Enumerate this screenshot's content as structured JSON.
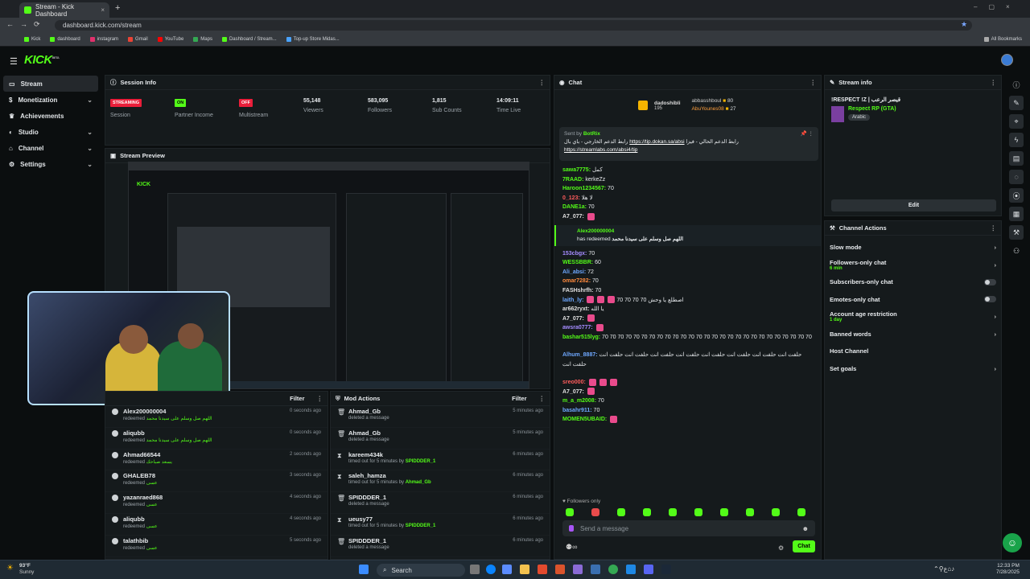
{
  "browser": {
    "tab_title": "Stream - Kick Dashboard",
    "url": "dashboard.kick.com/stream",
    "bookmarks": [
      "Kick",
      "dashboard",
      "instagram",
      "Gmail",
      "YouTube",
      "Maps",
      "Dashboard / Stream...",
      "Top-up Store Midas..."
    ],
    "all_bookmarks": "All Bookmarks"
  },
  "app": {
    "logo": "KICK",
    "logo_sup": "BETA"
  },
  "sidebar": {
    "items": [
      {
        "label": "Stream"
      },
      {
        "label": "Monetization"
      },
      {
        "label": "Achievements"
      },
      {
        "label": "Studio"
      },
      {
        "label": "Channel"
      },
      {
        "label": "Settings"
      }
    ]
  },
  "session": {
    "title": "Session Info",
    "stats": [
      {
        "badge": "STREAMING",
        "label": "Session"
      },
      {
        "badge": "ON",
        "label": "Partner Income"
      },
      {
        "badge": "OFF",
        "label": "Multistream"
      },
      {
        "value": "55,148",
        "label": "Viewers"
      },
      {
        "value": "583,095",
        "label": "Followers"
      },
      {
        "value": "1,815",
        "label": "Sub Counts"
      },
      {
        "value": "14:09:11",
        "label": "Time Live"
      }
    ]
  },
  "preview": {
    "title": "Stream Preview"
  },
  "activity": {
    "filter": "Filter",
    "items": [
      {
        "name": "Alex200000004",
        "sub": "redeemed",
        "extra": "اللهم صل وسلم على سيدنا محمد",
        "time": "0 seconds ago"
      },
      {
        "name": "aliqubb",
        "sub": "redeemed",
        "extra": "اللهم صل وسلم على سيدنا محمد",
        "time": "0 seconds ago"
      },
      {
        "name": "Ahmad66544",
        "sub": "redeemed",
        "extra": "يسعد صباحك",
        "time": "2 seconds ago"
      },
      {
        "name": "GHALEB78",
        "sub": "redeemed",
        "extra": "عسى",
        "time": "3 seconds ago"
      },
      {
        "name": "yazanraed868",
        "sub": "redeemed",
        "extra": "عسى",
        "time": "4 seconds ago"
      },
      {
        "name": "aliqubb",
        "sub": "redeemed",
        "extra": "عسى",
        "time": "4 seconds ago"
      },
      {
        "name": "talathbib",
        "sub": "redeemed",
        "extra": "عسى",
        "time": "5 seconds ago"
      }
    ]
  },
  "mod_actions": {
    "title": "Mod Actions",
    "filter": "Filter",
    "items": [
      {
        "name": "Ahmad_Gb",
        "sub": "deleted a message",
        "by": "",
        "time": "5 minutes ago"
      },
      {
        "name": "Ahmad_Gb",
        "sub": "deleted a message",
        "by": "",
        "time": "5 minutes ago"
      },
      {
        "name": "kareem434k",
        "sub": "timed out for 5 minutes by",
        "by": "SPIDDDER_1",
        "time": "6 minutes ago"
      },
      {
        "name": "saleh_hamza",
        "sub": "timed out for 5 minutes by",
        "by": "Ahmad_Gb",
        "time": "6 minutes ago"
      },
      {
        "name": "SPIDDDER_1",
        "sub": "deleted a message",
        "by": "",
        "time": "6 minutes ago"
      },
      {
        "name": "ueusy77",
        "sub": "timed out for 5 minutes by",
        "by": "SPIDDDER_1",
        "time": "6 minutes ago"
      },
      {
        "name": "SPIDDDER_1",
        "sub": "deleted a message",
        "by": "",
        "time": "6 minutes ago"
      }
    ]
  },
  "chat": {
    "title": "Chat",
    "top_gifter": {
      "name": "dadoshibli",
      "count": "195"
    },
    "gifters": [
      {
        "name": "abbasshboul",
        "count": "80"
      },
      {
        "name": "AbuYounes08",
        "count": "27"
      }
    ],
    "pinned": {
      "sent_by": "Sent by",
      "bot": "BotRix",
      "text": "رابط الدعم الحالي - فيزا",
      "link1": "https://tip.dokan.sa/absi",
      "text2": "رابط الدعم الخارجي - باي بال",
      "link2": "https://streamlabs.com/absi4/tip"
    },
    "messages": [
      {
        "user": "sawa7775:",
        "text": "كمل",
        "color": "#53fc18"
      },
      {
        "user": "7RAAD:",
        "text": "kerkeZz",
        "color": "#53fc18"
      },
      {
        "user": "Haroon1234567:",
        "text": "70",
        "color": "#53fc18"
      },
      {
        "user": "0_123:",
        "text": "لا هلا",
        "color": "#ff5c5c"
      },
      {
        "user": "DANE1a:",
        "text": "70",
        "color": "#53fc18"
      },
      {
        "user": "A7_077:",
        "text": "",
        "color": "#e0e0e0",
        "emote": 1
      },
      {
        "user": "153cbgx:",
        "text": "70",
        "color": "#a58cff"
      },
      {
        "user": "WESSBBR:",
        "text": "60",
        "color": "#53fc18"
      },
      {
        "user": "Ali_absi:",
        "text": "72",
        "color": "#6ea8ff"
      },
      {
        "user": "omar7282:",
        "text": "70",
        "color": "#ff8a3d"
      },
      {
        "user": "FASHshrfh:",
        "text": "70",
        "color": "#e0e0e0"
      },
      {
        "user": "laith_ly:",
        "text": "70 70 70 70 اصطلع يا وحش",
        "color": "#6ea8ff",
        "emote": 3
      },
      {
        "user": "ar662ryxt:",
        "text": "يا الله",
        "color": "#e0e0e0"
      },
      {
        "user": "A7_077:",
        "text": "",
        "color": "#e0e0e0",
        "emote": 1
      },
      {
        "user": "awsra0777:",
        "text": "",
        "color": "#a58cff",
        "emote": 1
      },
      {
        "user": "bashar515lyg:",
        "text": "70 70 70 70 70 70 70 70 70 70 70 70 70 70 70 70 70 70 70 70 70 70 70 70 70 70 70",
        "color": "#53fc18"
      },
      {
        "user": "Alhum_8887:",
        "text": "حلفت انت حلفت انت حلفت انت حلفت انت حلفت انت حلفت انت حلفت انت حلفت انت حلفت انت",
        "color": "#6ea8ff",
        "long": true
      },
      {
        "user": "sreo000:",
        "text": "",
        "color": "#ff5c5c",
        "emote": 3
      },
      {
        "user": "A7_077:",
        "text": "",
        "color": "#e0e0e0",
        "emote": 1
      },
      {
        "user": "m_a_m2008:",
        "text": "70",
        "color": "#53fc18"
      },
      {
        "user": "basahr911:",
        "text": "70",
        "color": "#6ea8ff"
      },
      {
        "user": "MOMEN5UBAID:",
        "text": "",
        "color": "#53fc18",
        "emote": 1
      }
    ],
    "redeem": {
      "user": "Alex200000004",
      "text": "has redeemed",
      "reward": "اللهم صل وسلم على سيدنا محمد"
    },
    "followers_only": "Followers only",
    "input_placeholder": "Send a message",
    "send_button": "Chat"
  },
  "stream_info": {
    "title": "Stream info",
    "stream_title": "!RESPECT !Z | قيصر الرعب",
    "category": "Respect RP (GTA)",
    "language": "Arabic",
    "edit_button": "Edit"
  },
  "channel_actions": {
    "title": "Channel Actions",
    "items": [
      {
        "label": "Slow mode",
        "sub": "",
        "control": "chevron"
      },
      {
        "label": "Followers-only chat",
        "sub": "6 min",
        "control": "chevron"
      },
      {
        "label": "Subscribers-only chat",
        "sub": "",
        "control": "toggle"
      },
      {
        "label": "Emotes-only chat",
        "sub": "",
        "control": "toggle"
      },
      {
        "label": "Account age restriction",
        "sub": "1 day",
        "control": "chevron"
      },
      {
        "label": "Banned words",
        "sub": "",
        "control": "chevron"
      },
      {
        "label": "Host Channel",
        "sub": "",
        "control": "none"
      },
      {
        "label": "Set goals",
        "sub": "",
        "control": "chevron"
      }
    ]
  },
  "taskbar": {
    "weather_temp": "93°F",
    "weather_desc": "Sunny",
    "search": "Search",
    "time": "12:33 PM",
    "date": "7/28/2025"
  },
  "colors": {
    "accent": "#53fc18",
    "streaming": "#e91e3a",
    "panel": "#151a1c"
  }
}
